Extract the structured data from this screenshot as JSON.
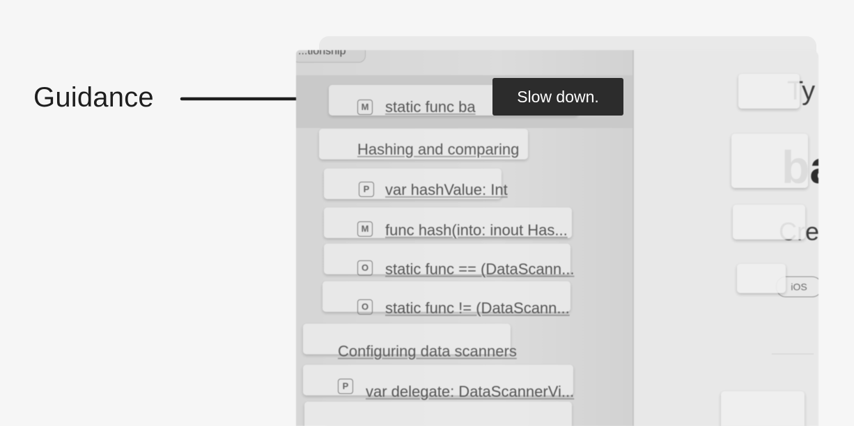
{
  "annotation": {
    "label": "Guidance"
  },
  "tooltip": {
    "text": "Slow down."
  },
  "list": {
    "top_fragment": "...tionship",
    "rows": [
      {
        "symbol": "M",
        "text": "static func ba"
      },
      {
        "text": "Hashing and comparing"
      },
      {
        "symbol": "P",
        "text": "var hashValue: Int"
      },
      {
        "symbol": "M",
        "text": "func hash(into: inout Has..."
      },
      {
        "symbol": "O",
        "text": "static func == (DataScann..."
      },
      {
        "symbol": "O",
        "text": "static func != (DataScann..."
      },
      {
        "text": "Configuring data scanners"
      },
      {
        "symbol": "P",
        "text": "var delegate: DataScannerVi..."
      }
    ]
  },
  "detail": {
    "fragment_1": "Ty",
    "fragment_2": "ba",
    "fragment_3": "Cre",
    "badge": "iOS"
  }
}
